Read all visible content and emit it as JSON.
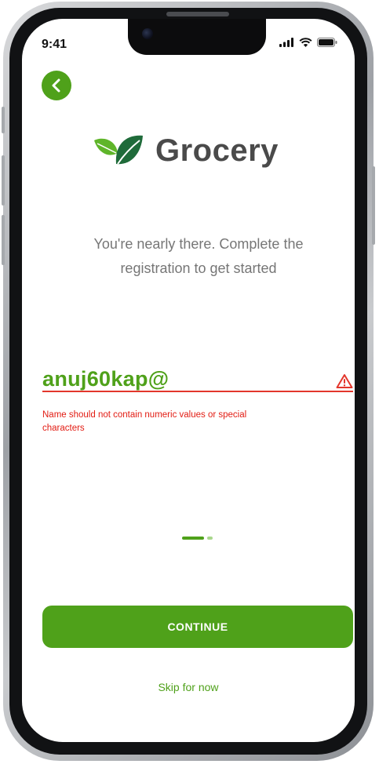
{
  "status_bar": {
    "time": "9:41"
  },
  "brand": {
    "name": "Grocery",
    "accent": "#4fa11a",
    "icon": "leaf-icon"
  },
  "main": {
    "subtitle": "You're nearly there. Complete the registration to get started",
    "name_field": {
      "value": "anuj60kap@"
    },
    "error_message": "Name should not contain numeric values or special characters",
    "pager": {
      "current": 1,
      "total": 2
    },
    "continue_label": "CONTINUE",
    "skip_label": "Skip for now"
  },
  "colors": {
    "error": "#e3362c",
    "text_muted": "#767676",
    "brand_text": "#4a4a4a"
  }
}
